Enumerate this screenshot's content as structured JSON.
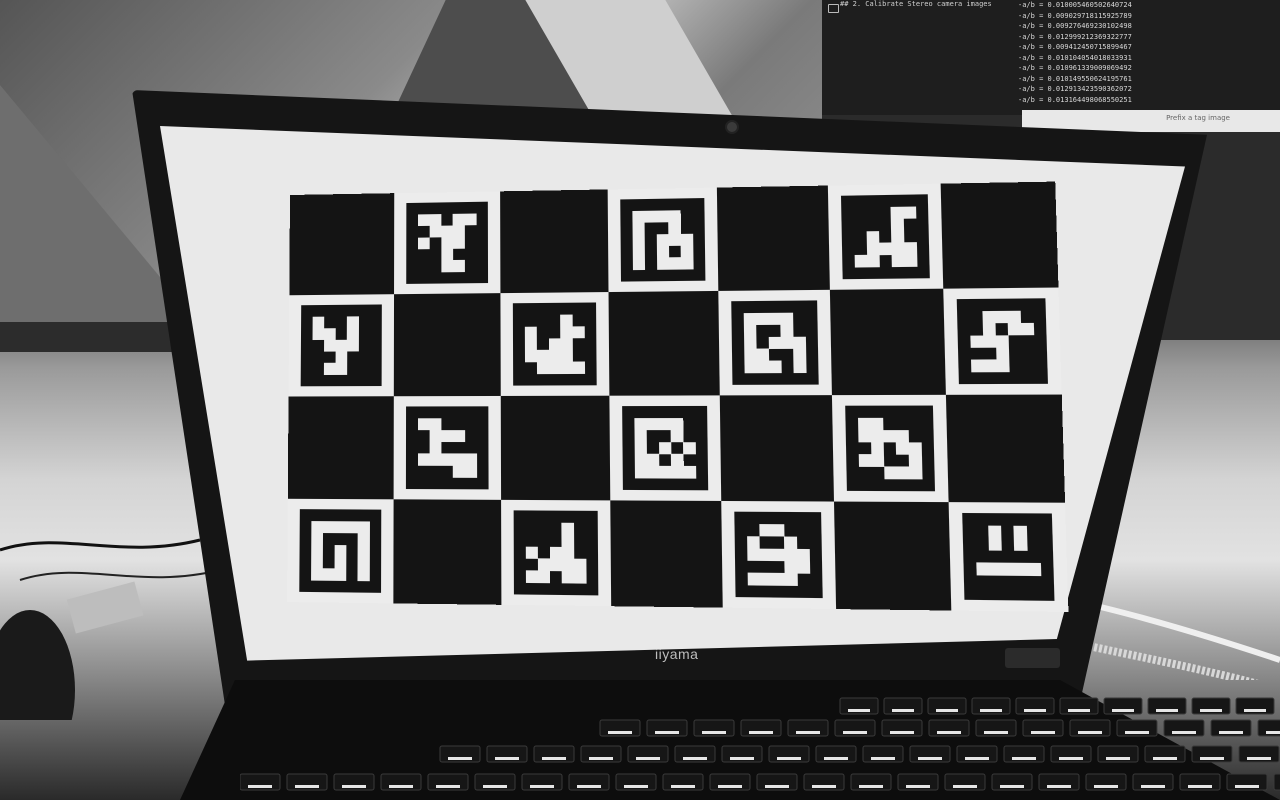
{
  "scene": {
    "background_code": {
      "heading": "## 2. Calibrate Stereo camera images",
      "lines": [
        "-a/b = 0.010005460502640724",
        "-a/b = 0.009029718115925789",
        "-a/b = 0.009276469230102498",
        "-a/b = 0.012999212369322777",
        "-a/b = 0.009412450715899467",
        "-a/b = 0.010104054018033931",
        "-a/b = 0.010961339009069492",
        "-a/b = 0.010149550624195761",
        "-a/b = 0.012913423590362072",
        "-a/b = 0.013164498068550251"
      ],
      "strip_label": "Prefix a tag image"
    },
    "laptop": {
      "brand": "iiyama",
      "screen_content": "ChArUco calibration board",
      "board": {
        "rows": 4,
        "cols": 7,
        "colors": {
          "dark": "#141414",
          "light": "#ececec"
        },
        "cells": [
          [
            "black",
            "marker-1",
            "black",
            "marker-2",
            "black",
            "marker-3",
            "black"
          ],
          [
            "marker-4",
            "black",
            "marker-5",
            "black",
            "marker-6",
            "black",
            "marker-7"
          ],
          [
            "black",
            "marker-8",
            "black",
            "marker-9",
            "black",
            "marker-10",
            "black"
          ],
          [
            "marker-11",
            "black",
            "marker-12",
            "black",
            "marker-13",
            "black",
            "marker-14"
          ]
        ]
      }
    }
  }
}
